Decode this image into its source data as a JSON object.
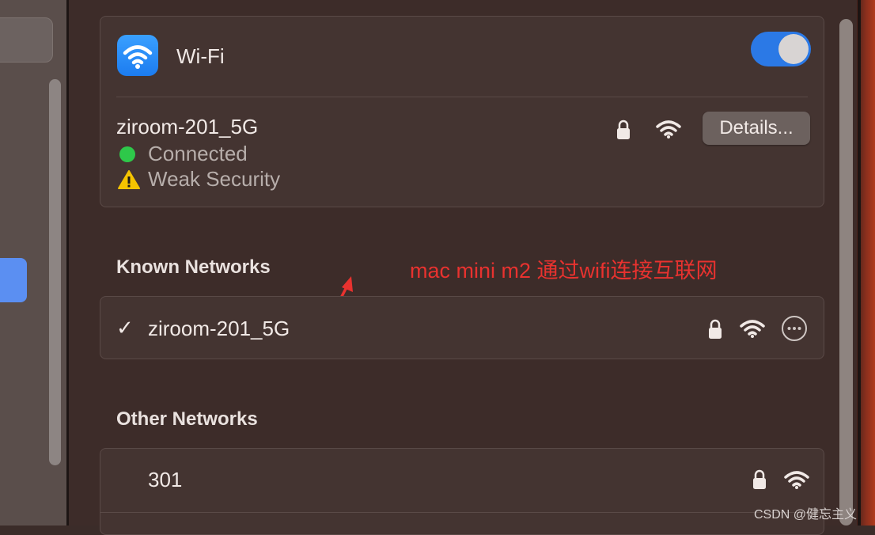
{
  "wifi": {
    "title": "Wi-Fi",
    "enabled": true,
    "current_network": {
      "name": "ziroom-201_5G",
      "status": "Connected",
      "security_warning": "Weak Security",
      "details_label": "Details..."
    }
  },
  "known_networks": {
    "title": "Known Networks",
    "items": [
      {
        "name": "ziroom-201_5G",
        "checked": true,
        "checkmark": "✓"
      }
    ]
  },
  "other_networks": {
    "title": "Other Networks",
    "items": [
      {
        "name": "301"
      }
    ]
  },
  "annotation": {
    "text": "mac mini m2 通过wifi连接互联网",
    "color": "#e8322f"
  },
  "watermark": "CSDN @健忘主义",
  "colors": {
    "accent": "#2b79e6",
    "connected": "#2ec84a",
    "warning": "#f5c400"
  },
  "icons": [
    "wifi-app-icon",
    "lock-icon",
    "wifi-signal-icon",
    "warning-icon",
    "checkmark-icon",
    "more-options-icon",
    "annotation-arrow"
  ]
}
